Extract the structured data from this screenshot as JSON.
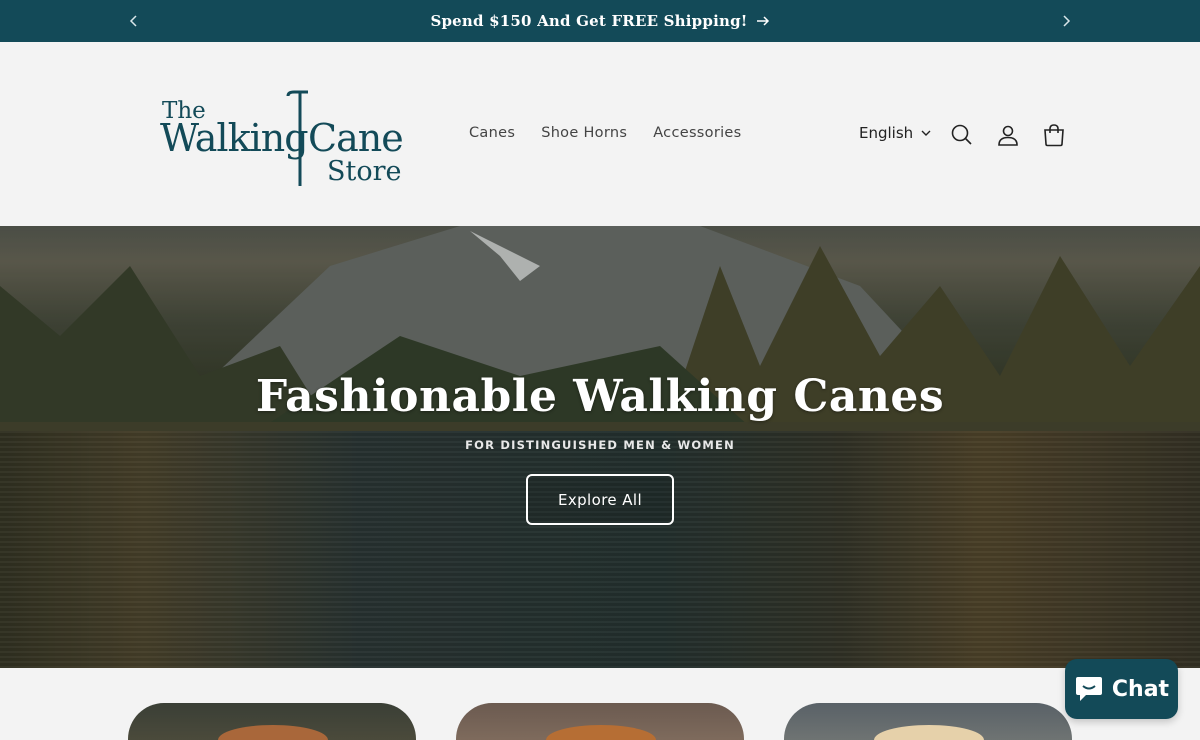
{
  "announcement": {
    "text": "Spend $150 And Get FREE Shipping!",
    "prev_icon": "chevron-left-icon",
    "next_icon": "chevron-right-icon",
    "arrow_icon": "arrow-right-icon"
  },
  "logo": {
    "line1": "The",
    "line2a": "Walking",
    "line2b": "Cane",
    "line3": "Store"
  },
  "nav": {
    "items": [
      {
        "label": "Canes"
      },
      {
        "label": "Shoe Horns"
      },
      {
        "label": "Accessories"
      }
    ]
  },
  "header": {
    "language": "English",
    "icons": [
      "search-icon",
      "account-icon",
      "cart-icon"
    ]
  },
  "hero": {
    "title": "Fashionable Walking Canes",
    "subtitle": "FOR DISTINGUISHED MEN & WOMEN",
    "button_label": "Explore All"
  },
  "chat": {
    "label": "Chat"
  },
  "colors": {
    "brand": "#134a58",
    "background": "#f3f3f3"
  }
}
